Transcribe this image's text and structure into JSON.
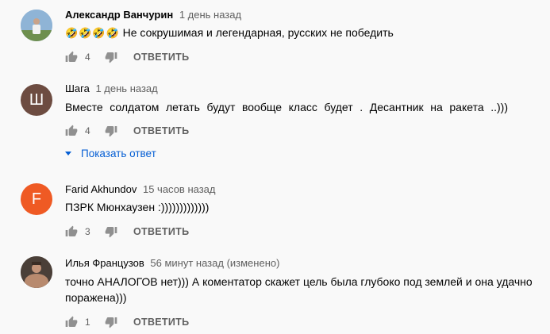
{
  "comments": [
    {
      "author": "Александр Ванчурин",
      "time": "1 день назад",
      "emoji": "🤣🤣🤣🤣",
      "text": "Не сокрушимая и легендарная, русских не победить",
      "likes": "4",
      "reply_label": "ОТВЕТИТЬ",
      "avatar_bg": "#7fa3c4"
    },
    {
      "author": "Шага",
      "time": "1 день назад",
      "text": "Вместе солдатом летать будут вообще класс будет . Десантник на ракета ..)))",
      "likes": "4",
      "reply_label": "ОТВЕТИТЬ",
      "avatar_letter": "Ш",
      "avatar_bg": "#6d4c41",
      "show_replies": "Показать ответ"
    },
    {
      "author": "Farid Akhundov",
      "time": "15 часов назад",
      "text": "ПЗРК Мюнхаузен :)))))))))))))",
      "likes": "3",
      "reply_label": "ОТВЕТИТЬ",
      "avatar_letter": "F",
      "avatar_bg": "#ef5a24"
    },
    {
      "author": "Илья Французов",
      "time": "56 минут назад (изменено)",
      "text_line1": "точно АНАЛОГОВ нет))) А коментатор скажет цель была глубоко под землей и она удачно",
      "text_line2": "поражена)))",
      "likes": "1",
      "reply_label": "ОТВЕТИТЬ",
      "avatar_bg": "#5a4a40"
    }
  ],
  "icons": {
    "like": "thumb-up-icon",
    "dislike": "thumb-down-icon",
    "expand": "triangle-down-icon"
  },
  "colors": {
    "link": "#065fd4",
    "secondary_text": "#606060",
    "icon": "#909090"
  }
}
